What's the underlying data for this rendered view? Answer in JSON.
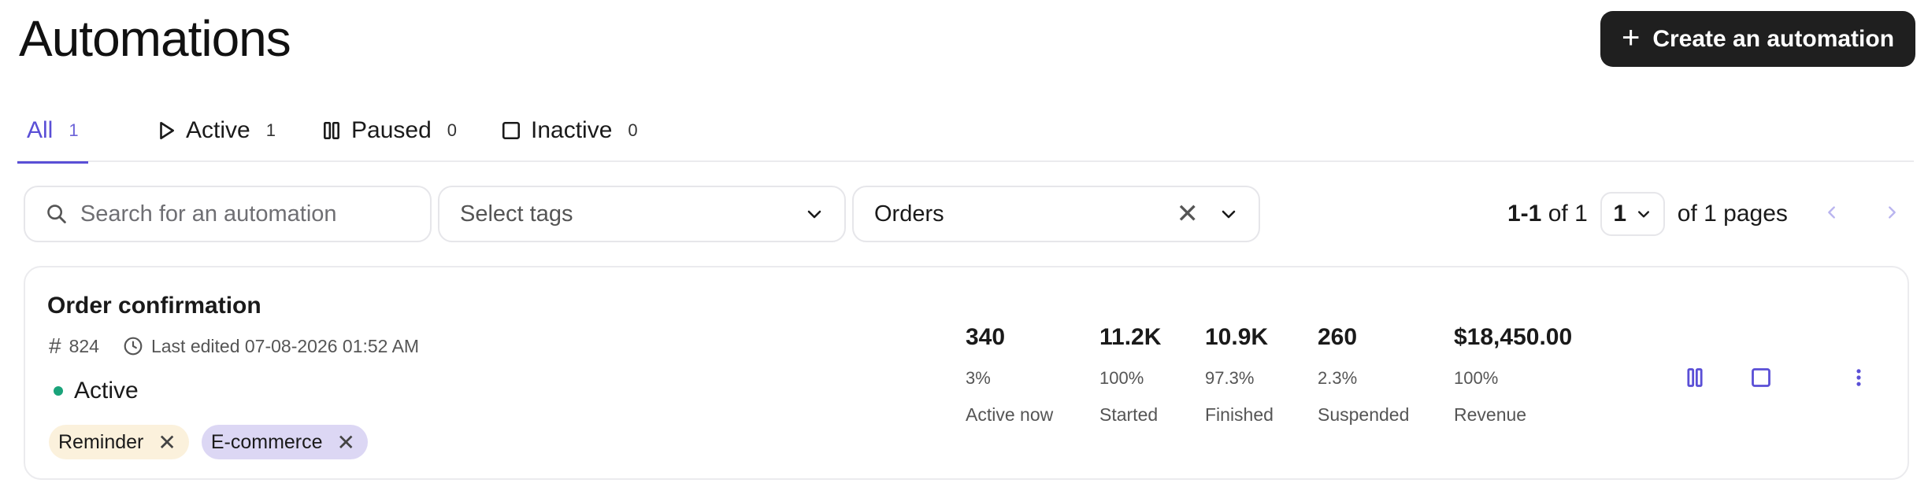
{
  "header": {
    "title": "Automations",
    "create_label": "Create an automation",
    "create_icon": "plus-icon"
  },
  "tabs": [
    {
      "label": "All",
      "count": "1",
      "icon": "",
      "selected": true
    },
    {
      "label": "Active",
      "count": "1",
      "icon": "play-icon",
      "selected": false
    },
    {
      "label": "Paused",
      "count": "0",
      "icon": "pause-icon",
      "selected": false
    },
    {
      "label": "Inactive",
      "count": "0",
      "icon": "stop-icon",
      "selected": false
    }
  ],
  "filters": {
    "search_placeholder": "Search for an automation",
    "tags_placeholder": "Select tags",
    "type_value": "Orders"
  },
  "pagination": {
    "range": "1-1",
    "of_label": "of",
    "total": "1",
    "page_value": "1",
    "pages_label": "of 1 pages"
  },
  "automation": {
    "title": "Order confirmation",
    "id": "824",
    "last_edited": "Last edited 07-08-2026 01:52 AM",
    "status": "Active",
    "status_color": "#1aa37a",
    "tags": [
      {
        "label": "Reminder",
        "color": "#fbf1dc"
      },
      {
        "label": "E-commerce",
        "color": "#dcd7f4"
      }
    ],
    "stats": [
      {
        "value": "340",
        "percent": "3%",
        "label": "Active now"
      },
      {
        "value": "11.2K",
        "percent": "100%",
        "label": "Started"
      },
      {
        "value": "10.9K",
        "percent": "97.3%",
        "label": "Finished"
      },
      {
        "value": "260",
        "percent": "2.3%",
        "label": "Suspended"
      },
      {
        "value": "$18,450.00",
        "percent": "100%",
        "label": "Revenue"
      }
    ],
    "actions": [
      "pause-icon",
      "stop-icon",
      "more-vertical-icon"
    ]
  },
  "colors": {
    "accent": "#5a4fd6",
    "button_dark": "#1f1f1f"
  }
}
